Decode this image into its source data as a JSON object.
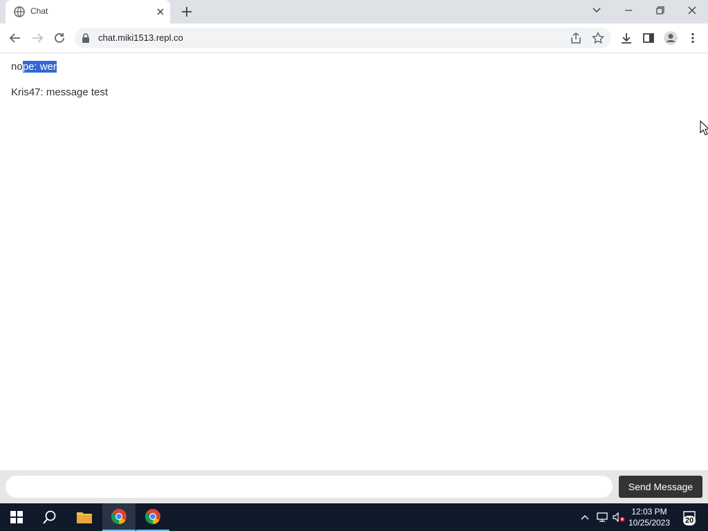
{
  "browser": {
    "tab_title": "Chat",
    "url": "chat.miki1513.repl.co"
  },
  "messages": [
    {
      "prefix": "no",
      "selected": "pe: wer"
    },
    {
      "text": "Kris47: message test"
    }
  ],
  "composer": {
    "input_value": "",
    "send_label": "Send Message"
  },
  "taskbar": {
    "time": "12:03 PM",
    "date": "10/25/2023",
    "notification_count": "20"
  },
  "colors": {
    "selection": "#3367d6",
    "send_button": "#333333",
    "taskbar": "#101a2b"
  }
}
